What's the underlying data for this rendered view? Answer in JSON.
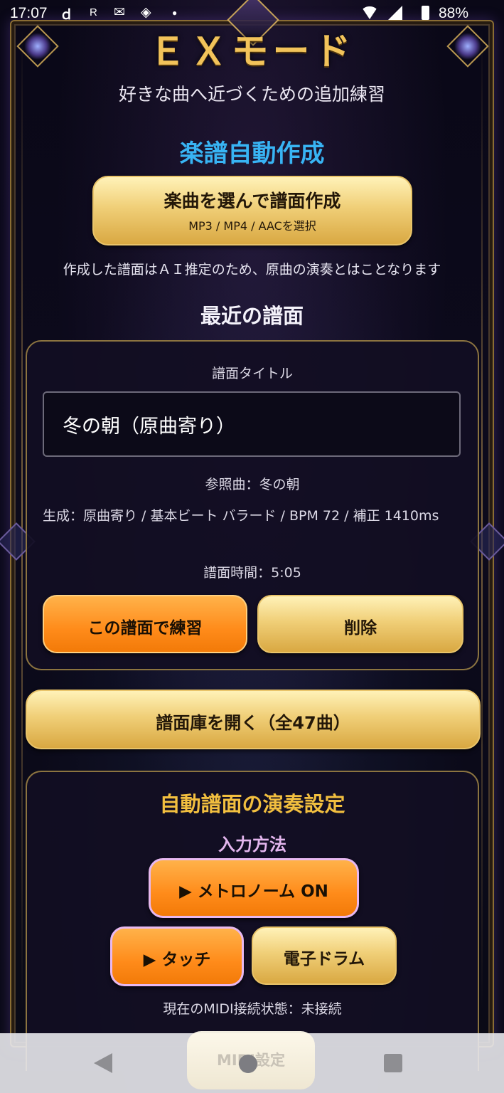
{
  "status_bar": {
    "time": "17:07",
    "battery_percent": "88%",
    "icons": [
      "d-app-icon",
      "r-app-icon",
      "mail-icon",
      "diamond-app-icon",
      "dot-icon",
      "wifi-icon",
      "signal-icon",
      "battery-icon"
    ]
  },
  "header": {
    "title": "ＥＸモード",
    "subtitle": "好きな曲へ近づくための追加練習"
  },
  "auto_create": {
    "section_title": "楽譜自動作成",
    "button_label": "楽曲を選んで譜面作成",
    "button_sub": "MP3 / MP4 / AACを選択",
    "note": "作成した譜面はＡＩ推定のため、原曲の演奏とはことなります"
  },
  "recent": {
    "section_title": "最近の譜面",
    "title_label": "譜面タイトル",
    "title_value": "冬の朝（原曲寄り）",
    "reference_song": "参照曲：冬の朝",
    "generation_info": "生成：原曲寄り / 基本ビート バラード / BPM 72 / 補正 1410ms",
    "duration": "譜面時間：5:05",
    "practice_button": "この譜面で練習",
    "delete_button": "削除"
  },
  "library_button": "譜面庫を開く（全47曲）",
  "play_settings": {
    "section_title": "自動譜面の演奏設定",
    "input_method_label": "入力方法",
    "metronome_button": "▶ メトロノーム ON",
    "touch_button": "▶ タッチ",
    "drum_button": "電子ドラム",
    "midi_status": "現在のMIDI接続状態：未接続",
    "midi_settings_button": "MIDI設定"
  },
  "colors": {
    "gold_title": "#f2c35a",
    "blue_heading": "#38b4f4",
    "orange_button": "#ff8b1a",
    "gold_button": "#f0cf78",
    "lavender_text": "#e4b6ee",
    "background": "#07060f"
  }
}
